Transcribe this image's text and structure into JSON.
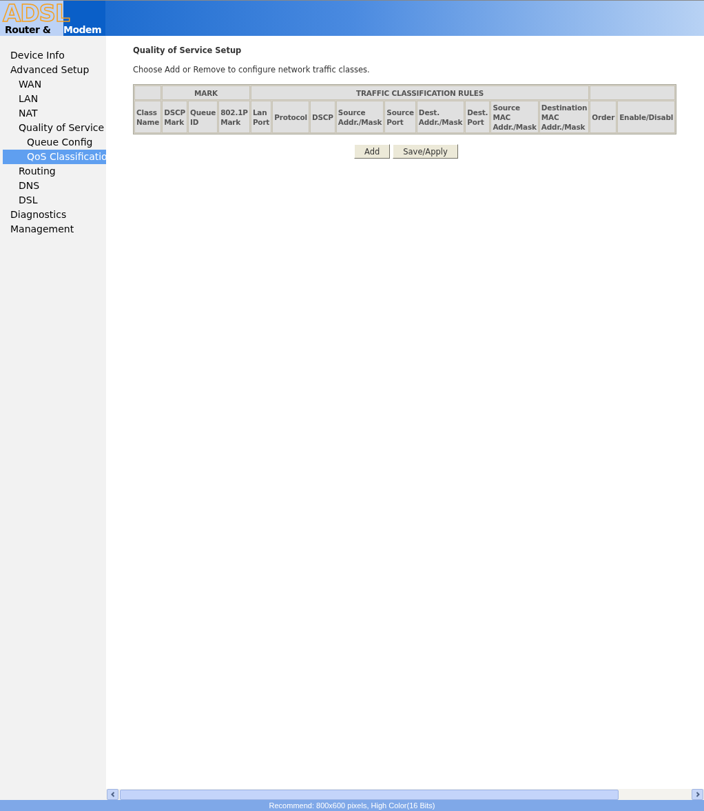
{
  "header": {
    "logo_big": "ADSL",
    "logo_dark": "Router &",
    "logo_light": "Modem"
  },
  "sidebar": {
    "items": [
      {
        "label": "Device Info",
        "selected": false
      },
      {
        "label": "Advanced Setup",
        "selected": false,
        "children": [
          {
            "label": "WAN",
            "selected": false
          },
          {
            "label": "LAN",
            "selected": false
          },
          {
            "label": "NAT",
            "selected": false
          },
          {
            "label": "Quality of Service",
            "selected": false,
            "children": [
              {
                "label": "Queue Config",
                "selected": false
              },
              {
                "label": "QoS Classificatio",
                "selected": true
              }
            ]
          },
          {
            "label": "Routing",
            "selected": false
          },
          {
            "label": "DNS",
            "selected": false
          },
          {
            "label": "DSL",
            "selected": false
          }
        ]
      },
      {
        "label": "Diagnostics",
        "selected": false
      },
      {
        "label": "Management",
        "selected": false
      }
    ]
  },
  "content": {
    "title": "Quality of Service Setup",
    "description": "Choose Add or Remove to configure network traffic classes.",
    "table": {
      "groups": [
        "MARK",
        "TRAFFIC CLASSIFICATION RULES"
      ],
      "columns": [
        [
          "Class",
          "Name"
        ],
        [
          "DSCP",
          "Mark"
        ],
        [
          "Queue",
          "ID"
        ],
        [
          "802.1P",
          "Mark"
        ],
        [
          "Lan",
          "Port"
        ],
        [
          "Protocol"
        ],
        [
          "DSCP"
        ],
        [
          "Source",
          "Addr./Mask"
        ],
        [
          "Source",
          "Port"
        ],
        [
          "Dest.",
          "Addr./Mask"
        ],
        [
          "Dest.",
          "Port"
        ],
        [
          "Source",
          "MAC",
          "Addr./Mask"
        ],
        [
          "Destination",
          "MAC",
          "Addr./Mask"
        ],
        [
          "Order"
        ],
        [
          "Enable/Disabl"
        ]
      ]
    },
    "buttons": [
      "Add",
      "Save/Apply"
    ]
  },
  "status_bar": "Recommend: 800x600 pixels, High Color(16 Bits)"
}
